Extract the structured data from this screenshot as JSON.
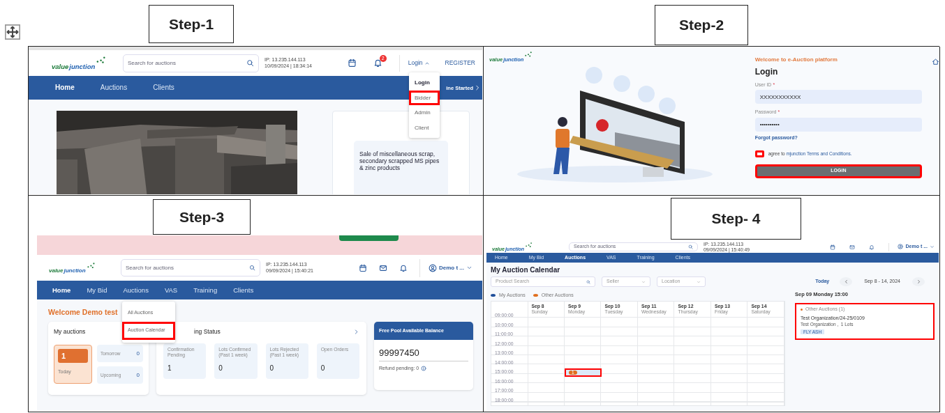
{
  "panels": [
    {
      "kind": "home",
      "step": "Step-1",
      "logo": [
        "value",
        "junction"
      ],
      "search_placeholder": "Search for auctions",
      "ip": "IP: 13.235.144.113",
      "datetime": "10/09/2024 | 18:34:14",
      "notification_count": "2",
      "login": "Login",
      "register": "REGISTER",
      "nav": [
        {
          "label": "Home",
          "selected": true
        },
        {
          "label": "Auctions",
          "selected": false
        },
        {
          "label": "Clients",
          "selected": false
        }
      ],
      "nav_right": "ine Started",
      "login_menu": [
        {
          "label": "Login",
          "kind": "header",
          "highlighted": false
        },
        {
          "label": "Bidder",
          "kind": "item",
          "highlighted": true
        },
        {
          "label": "Admin",
          "kind": "item",
          "highlighted": false
        },
        {
          "label": "Client",
          "kind": "item",
          "highlighted": false
        }
      ],
      "listing": "Sale of miscellaneous scrap, secondary scrapped MS pipes & zinc products"
    },
    {
      "kind": "login",
      "step": "Step-2",
      "logo": [
        "value",
        "junction"
      ],
      "welcome": "Welcome to e-Auction platform",
      "title": "Login",
      "fields": [
        {
          "label": "User ID",
          "required_mark": "*",
          "value": "XXXXXXXXXXX"
        },
        {
          "label": "Password",
          "required_mark": "*",
          "value": "••••••••••"
        }
      ],
      "forgot": "Forgot password?",
      "agree": {
        "checked": false,
        "highlighted": true,
        "text": "agree to",
        "link": "mjunction Terms and Conditions."
      },
      "button": {
        "label": "LOGIN",
        "highlighted": true
      }
    },
    {
      "kind": "dashboard",
      "step": "Step-3",
      "logo": [
        "value",
        "junction"
      ],
      "search_placeholder": "Search for auctions",
      "ip": "IP: 13.235.144.113",
      "datetime": "09/09/2024 | 15:40:21",
      "user": "Demo t ...",
      "nav": [
        {
          "label": "Home",
          "selected": true
        },
        {
          "label": "My Bid",
          "selected": false
        },
        {
          "label": "Auctions",
          "selected": false,
          "menu": [
            {
              "label": "All Auctions",
              "highlighted": false
            },
            {
              "label": "Auction Calendar",
              "highlighted": true
            }
          ]
        },
        {
          "label": "VAS",
          "selected": false
        },
        {
          "label": "Training",
          "selected": false
        },
        {
          "label": "Clients",
          "selected": false
        }
      ],
      "welcome": "Welcome Demo test",
      "my_auctions": {
        "title": "My auctions",
        "today": {
          "count": "1",
          "label": "Today"
        },
        "others": [
          {
            "label": "Tomorrow",
            "count": "0"
          },
          {
            "label": "Upcoming",
            "count": "0"
          }
        ]
      },
      "bidding": {
        "title": "ing Status",
        "stats": [
          {
            "label": "Confirmation Pending",
            "value": "1"
          },
          {
            "label": "Lots Confirmed (Past 1 week)",
            "value": "0"
          },
          {
            "label": "Lots Rejected (Past 1 week)",
            "value": "0"
          },
          {
            "label": "Open Orders",
            "value": "0"
          }
        ]
      },
      "balance": {
        "title": "Free Pool Available Balance",
        "amount": "99997450",
        "refund": "Refund pending: 0"
      }
    },
    {
      "kind": "calendar",
      "step": "Step- 4",
      "logo": [
        "value",
        "junction"
      ],
      "search_placeholder": "Search for auctions",
      "ip": "IP: 13.235.144.113",
      "datetime": "09/09/2024 | 15:40:49",
      "user": "Demo t ...",
      "nav": [
        {
          "label": "Home",
          "selected": false
        },
        {
          "label": "My Bid",
          "selected": false
        },
        {
          "label": "Auctions",
          "selected": true
        },
        {
          "label": "VAS",
          "selected": false
        },
        {
          "label": "Training",
          "selected": false
        },
        {
          "label": "Clients",
          "selected": false
        }
      ],
      "title": "My Auction Calendar",
      "filters": [
        {
          "placeholder": "Product Search",
          "kind": "search"
        },
        {
          "placeholder": "Seller",
          "kind": "select"
        },
        {
          "placeholder": "Location",
          "kind": "select"
        }
      ],
      "today": "Today",
      "range": "Sep 8 - 14, 2024",
      "legend": [
        {
          "label": "My Auctions",
          "color": "#1f4e9a"
        },
        {
          "label": "Other Auctions",
          "color": "#e07020"
        }
      ],
      "days": [
        {
          "date": "Sep 8",
          "weekday": "Sunday"
        },
        {
          "date": "Sep 9",
          "weekday": "Monday"
        },
        {
          "date": "Sep 10",
          "weekday": "Tuesday"
        },
        {
          "date": "Sep 11",
          "weekday": "Wednesday"
        },
        {
          "date": "Sep 12",
          "weekday": "Thursday"
        },
        {
          "date": "Sep 13",
          "weekday": "Friday"
        },
        {
          "date": "Sep 14",
          "weekday": "Saturday"
        }
      ],
      "rows": [
        {
          "time": "09:00:00"
        },
        {
          "time": "10:00:00"
        },
        {
          "time": "11:00:00"
        },
        {
          "time": "12:00:00"
        },
        {
          "time": "13:00:00"
        },
        {
          "time": "14:00:00"
        },
        {
          "time": "15:00:00",
          "cells": [
            null,
            {
              "count": "1",
              "highlighted": true
            },
            null,
            null,
            null,
            null,
            null
          ]
        },
        {
          "time": "16:00:00"
        },
        {
          "time": "17:00:00"
        },
        {
          "time": "18:00:00"
        }
      ],
      "detail": {
        "heading": "Sep 09 Monday 15:00",
        "group": "Other Auctions (1)",
        "auction": "Test Organization/24-25/0109",
        "sub": "Test Organization ,  1 Lots",
        "tag": "FLY ASH",
        "highlighted": true
      }
    }
  ]
}
